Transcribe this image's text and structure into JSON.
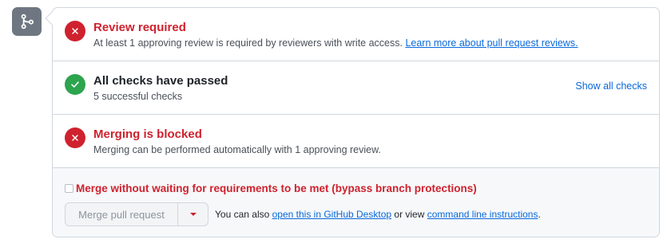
{
  "review": {
    "title": "Review required",
    "desc_prefix": "At least 1 approving review is required by reviewers with write access.",
    "link": "Learn more about pull request reviews."
  },
  "checks": {
    "title": "All checks have passed",
    "desc": "5 successful checks",
    "show_all": "Show all checks"
  },
  "blocked": {
    "title": "Merging is blocked",
    "desc": "Merging can be performed automatically with 1 approving review."
  },
  "merge": {
    "bypass_label": "Merge without waiting for requirements to be met (bypass branch protections)",
    "button_label": "Merge pull request",
    "helper_prefix": "You can also",
    "desktop_link": "open this in GitHub Desktop",
    "helper_middle": "or view",
    "cli_link": "command line instructions",
    "helper_suffix": "."
  },
  "colors": {
    "error": "#cf222e",
    "success": "#2da44e",
    "link": "#0969da",
    "icon_box": "#6e7781"
  },
  "icons": {
    "merge_box": "git-merge-icon",
    "error": "x-circle-icon",
    "success": "check-circle-icon",
    "dropdown": "triangle-down-icon"
  }
}
